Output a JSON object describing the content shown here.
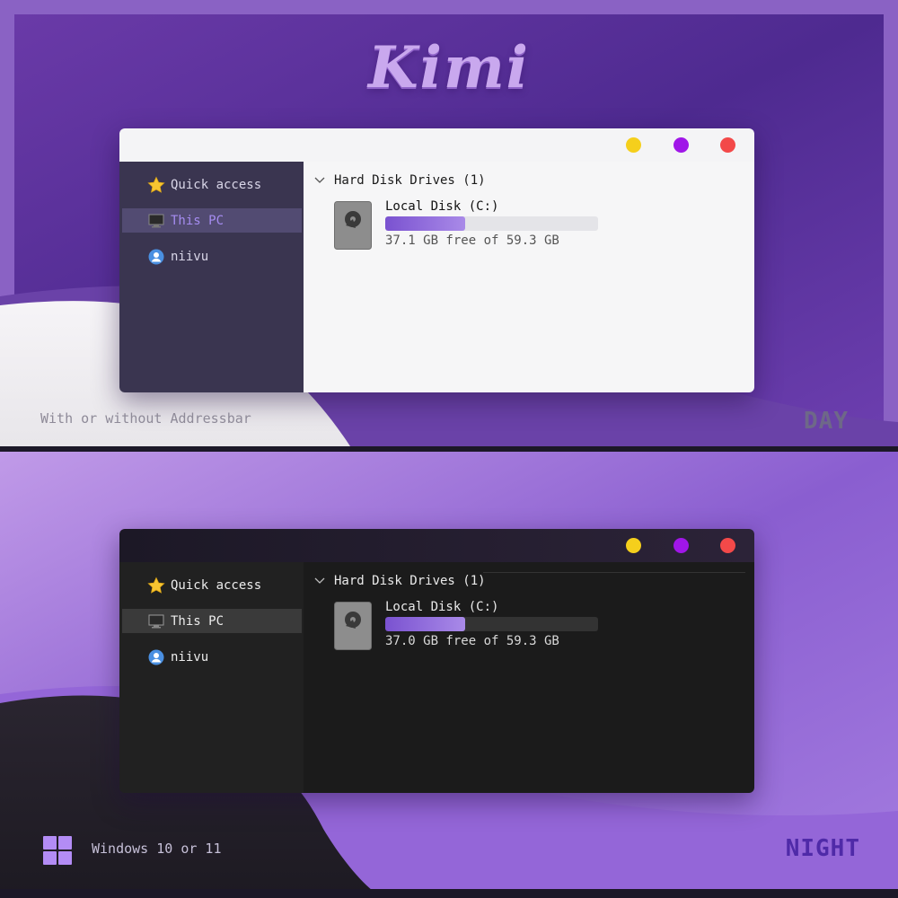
{
  "brand": {
    "title": "Kimi"
  },
  "day": {
    "window": {
      "controls": [
        "minimize-dot",
        "maximize-dot",
        "close-dot"
      ],
      "sidebar": [
        {
          "label": "Quick access",
          "icon": "star-icon"
        },
        {
          "label": "This PC",
          "icon": "monitor-icon",
          "selected": true
        },
        {
          "label": "niivu",
          "icon": "user-icon"
        }
      ],
      "group": {
        "label": "Hard Disk Drives (1)"
      },
      "drive": {
        "name": "Local Disk (C:)",
        "free_text": "37.1 GB free of 59.3 GB",
        "used_fraction": 0.374
      }
    },
    "caption": "With or without Addressbar",
    "mode_label": "DAY"
  },
  "night": {
    "window": {
      "controls": [
        "minimize-dot",
        "maximize-dot",
        "close-dot"
      ],
      "sidebar": [
        {
          "label": "Quick access",
          "icon": "star-icon"
        },
        {
          "label": "This PC",
          "icon": "monitor-icon",
          "selected": true
        },
        {
          "label": "niivu",
          "icon": "user-icon"
        }
      ],
      "group": {
        "label": "Hard Disk Drives (1)"
      },
      "drive": {
        "name": "Local Disk (C:)",
        "free_text": "37.0 GB free of 59.3 GB",
        "used_fraction": 0.376
      }
    },
    "caption": "Windows 10 or 11",
    "mode_label": "NIGHT"
  },
  "colors": {
    "accent": "#a58cf0",
    "dot_yellow": "#f5cf1c",
    "dot_purple": "#a016e8",
    "dot_red": "#f34949"
  }
}
